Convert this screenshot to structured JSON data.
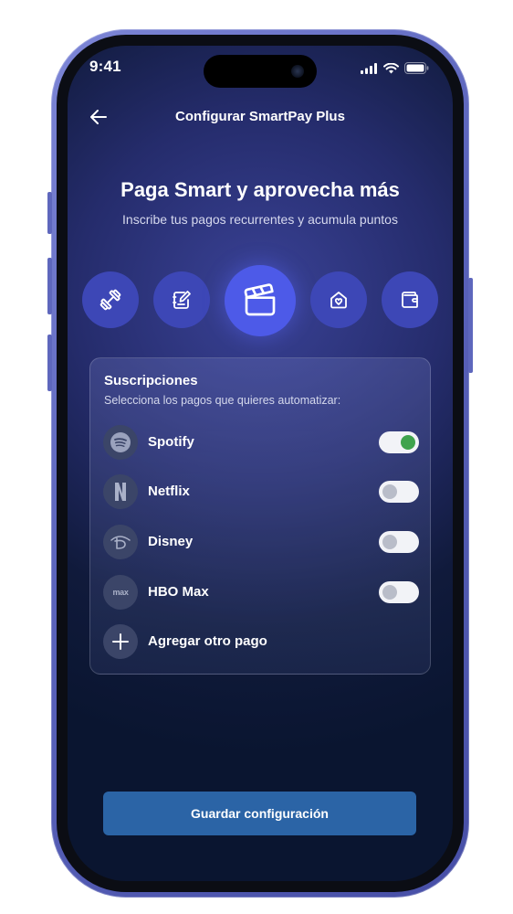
{
  "status_bar": {
    "time": "9:41"
  },
  "nav": {
    "title": "Configurar SmartPay Plus"
  },
  "hero": {
    "title": "Paga Smart y aprovecha más",
    "subtitle": "Inscribe tus pagos recurrentes y acumula puntos"
  },
  "categories": [
    {
      "icon": "dumbbell-icon",
      "active": false
    },
    {
      "icon": "notebook-edit-icon",
      "active": false
    },
    {
      "icon": "clapperboard-icon",
      "active": true
    },
    {
      "icon": "home-heart-icon",
      "active": false
    },
    {
      "icon": "wallet-icon",
      "active": false
    }
  ],
  "subscriptions": {
    "title": "Suscripciones",
    "subtitle": "Selecciona los pagos que quieres automatizar:",
    "items": [
      {
        "label": "Spotify",
        "icon": "spotify-logo",
        "enabled": true
      },
      {
        "label": "Netflix",
        "icon": "netflix-logo",
        "enabled": false
      },
      {
        "label": "Disney",
        "icon": "disney-logo",
        "enabled": false
      },
      {
        "label": "HBO Max",
        "icon": "max-logo",
        "logo_text": "max",
        "enabled": false
      }
    ],
    "add_label": "Agregar otro pago"
  },
  "save_button": {
    "label": "Guardar configuración"
  },
  "colors": {
    "accent": "#4D5AE8",
    "category_bg": "#3D47B6",
    "toggle_on": "#3FA34D",
    "button": "#2B64A6",
    "frame": "#5A63BB"
  }
}
